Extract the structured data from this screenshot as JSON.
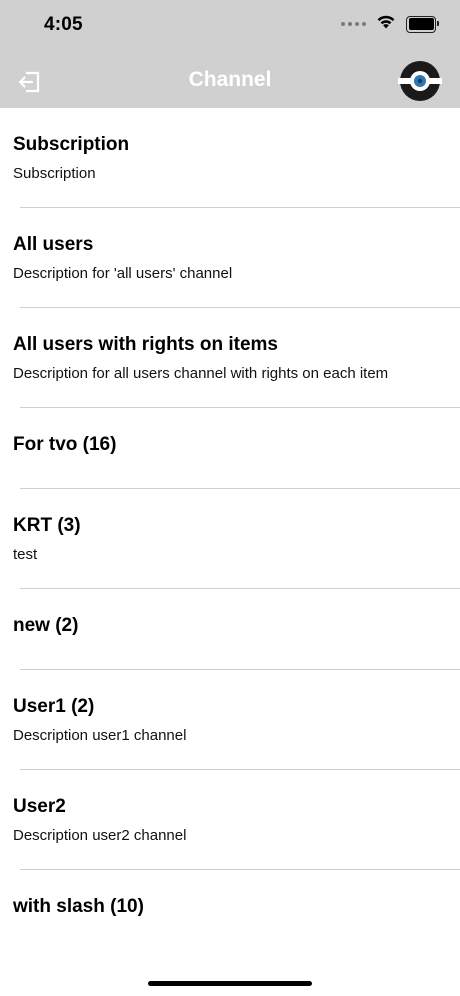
{
  "status_bar": {
    "time": "4:05",
    "icons": [
      "cellular-dots-icon",
      "wifi-icon",
      "battery-icon"
    ]
  },
  "nav": {
    "title": "Channel",
    "back_icon": "logout-icon",
    "logo_icon": "app-logo-icon"
  },
  "colors": {
    "header_bg": "#d0d0d0",
    "title_color": "#ffffff",
    "separator": "#cfcfcf",
    "logo_accent": "#2a78b6"
  },
  "channels": [
    {
      "title": "Subscription",
      "description": "Subscription"
    },
    {
      "title": "All users",
      "description": "Description for 'all users' channel"
    },
    {
      "title": "All users with rights on items",
      "description": "Description for all users channel with rights on each item"
    },
    {
      "title": "For tvo (16)",
      "description": ""
    },
    {
      "title": "KRT (3)",
      "description": "test"
    },
    {
      "title": "new (2)",
      "description": ""
    },
    {
      "title": "User1 (2)",
      "description": "Description user1 channel"
    },
    {
      "title": "User2",
      "description": "Description user2 channel"
    },
    {
      "title": "with slash (10)",
      "description": ""
    }
  ]
}
